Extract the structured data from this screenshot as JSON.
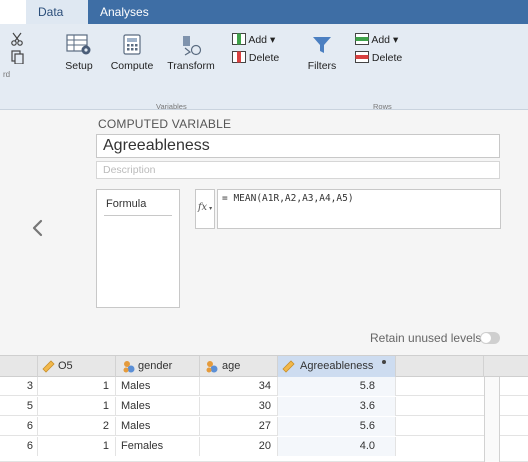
{
  "tabs": [
    {
      "label": "Data",
      "active": true
    },
    {
      "label": "Analyses",
      "active": false
    }
  ],
  "toolbar": {
    "cut_partial_label": "rd",
    "setup_label": "Setup",
    "compute_label": "Compute",
    "transform_label": "Transform",
    "variables_group_label": "Variables",
    "add_var_label": "Add ▾",
    "delete_var_label": "Delete",
    "filters_label": "Filters",
    "add_row_label": "Add ▾",
    "delete_row_label": "Delete",
    "rows_group_label": "Rows"
  },
  "computed_variable": {
    "section_label": "COMPUTED VARIABLE",
    "name": "Agreeableness",
    "description_placeholder": "Description",
    "formula_label": "Formula",
    "fx_label": "fx",
    "formula": "= MEAN(A1R,A2,A3,A4,A5)",
    "retain_unused_levels_label": "Retain unused levels",
    "retain_unused_levels": false
  },
  "grid": {
    "columns": [
      {
        "name": "O5",
        "icon": "ruler-icon"
      },
      {
        "name": "gender",
        "icon": "nominal-icon"
      },
      {
        "name": "age",
        "icon": "nominal-icon"
      },
      {
        "name": "Agreeableness",
        "icon": "ruler-icon",
        "selected": true
      }
    ],
    "rows": [
      {
        "index": "3",
        "o5": "1",
        "gender": "Males",
        "age": "34",
        "agreeableness": "5.8"
      },
      {
        "index": "5",
        "o5": "1",
        "gender": "Males",
        "age": "30",
        "agreeableness": "3.6"
      },
      {
        "index": "6",
        "o5": "2",
        "gender": "Males",
        "age": "27",
        "agreeableness": "5.6"
      },
      {
        "index": "6",
        "o5": "1",
        "gender": "Females",
        "age": "20",
        "agreeableness": "4.0"
      }
    ]
  },
  "colors": {
    "tab_bar_blue": "#3e6ea5",
    "toolbar_bg": "#e4ebf3",
    "selected_column": "#cddcf0",
    "ruler_icon": "#f2b84b",
    "nominal_icon_a": "#e59b3c",
    "nominal_icon_b": "#5b8fd6"
  }
}
